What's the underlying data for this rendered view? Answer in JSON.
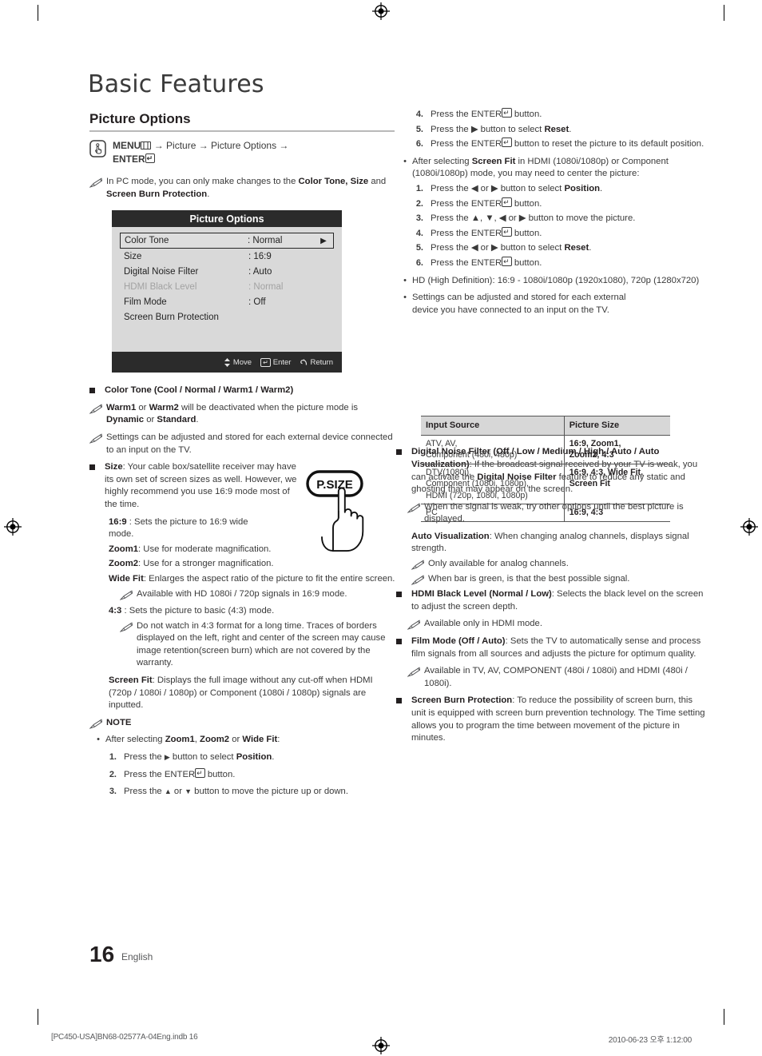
{
  "page": {
    "chapter_title": "Basic Features",
    "section_title": "Picture Options",
    "page_number": "16",
    "language": "English",
    "footer_file": "[PC450-USA]BN68-02577A-04Eng.indb   16",
    "footer_date": "2010-06-23   오후 1:12:00"
  },
  "menu_path": {
    "line1_a": "MENU",
    "line1_b": "→ Picture → Picture Options →",
    "line2": "ENTER"
  },
  "left": {
    "note_pc_mode_1": "In PC mode, you can only make changes to the ",
    "note_pc_mode_b1": "Color Tone, Size",
    "note_pc_mode_2": " and ",
    "note_pc_mode_b2": "Screen Burn Protection",
    "note_pc_mode_3": ".",
    "color_tone_heading": "Color Tone (Cool / Normal / Warm1 / Warm2)",
    "warm_note_b1": "Warm1",
    "warm_note_1": " or ",
    "warm_note_b2": "Warm2",
    "warm_note_2": " will be deactivated when the picture mode is ",
    "warm_note_b3": "Dynamic",
    "warm_note_3": " or ",
    "warm_note_b4": "Standard",
    "warm_note_4": ".",
    "settings_note": "Settings can be adjusted and stored for each external device connected to an input on the TV.",
    "size_label": "Size",
    "size_body": ": Your cable box/satellite receiver may have its own set of screen sizes as well. However, we highly recommend you use 16:9 mode most of the time.",
    "ratio_169_b": "16:9",
    "ratio_169_t": " : Sets the picture to 16:9 wide mode.",
    "zoom1_b": "Zoom1",
    "zoom1_t": ": Use for moderate magnification.",
    "zoom2_b": "Zoom2",
    "zoom2_t": ": Use for a stronger magnification.",
    "widefit_b": "Wide Fit",
    "widefit_t": ": Enlarges the aspect ratio of the picture to fit the entire screen.",
    "widefit_note": "Available with HD 1080i / 720p signals in 16:9 mode.",
    "ratio_43_b": "4:3",
    "ratio_43_t": " : Sets the picture to basic (4:3) mode.",
    "ratio_43_note": "Do not watch in 4:3 format for a long time. Traces of borders displayed on the left, right and center of the screen may cause image retention(screen burn) which are not covered by the warranty.",
    "screenfit_b": "Screen Fit",
    "screenfit_t": ": Displays the full image without any cut-off when HDMI (720p / 1080i / 1080p) or Component (1080i / 1080p) signals are inputted.",
    "note_heading": "NOTE",
    "note_bullet_1a": "After selecting ",
    "note_bullet_1b": "Zoom1",
    "note_bullet_1c": ", ",
    "note_bullet_1d": "Zoom2",
    "note_bullet_1e": " or ",
    "note_bullet_1f": "Wide Fit",
    "note_bullet_1g": ":",
    "steps": [
      {
        "n": "1.",
        "pre": "Press the ",
        "glyph": "▶",
        "mid": " button to select ",
        "bold": "Position",
        "post": "."
      },
      {
        "n": "2.",
        "pre": "Press the ENTER",
        "glyph": "",
        "mid": " button.",
        "bold": "",
        "post": ""
      },
      {
        "n": "3.",
        "pre": "Press the ",
        "glyph": "▲",
        "mid": " or ",
        "bold": "",
        "post": " button to move the picture up or down."
      }
    ]
  },
  "right": {
    "steps_a": [
      {
        "n": "4.",
        "text_pre": "Press the ENTER",
        "text_post": " button."
      },
      {
        "n": "5.",
        "text_pre": "Press the ▶ button to select ",
        "bold": "Reset",
        "text_post": "."
      },
      {
        "n": "6.",
        "text_pre": "Press the ENTER",
        "text_post": " button to reset the picture to its default position."
      }
    ],
    "bullet_screenfit_a": "After selecting ",
    "bullet_screenfit_b": "Screen Fit",
    "bullet_screenfit_c": " in HDMI (1080i/1080p) or Component (1080i/1080p) mode, you may need to center the picture:",
    "steps_b": [
      {
        "n": "1.",
        "text_pre": "Press the ◀ or ▶ button to select ",
        "bold": "Position",
        "text_post": "."
      },
      {
        "n": "2.",
        "text_pre": "Press the ENTER",
        "text_post": " button."
      },
      {
        "n": "3.",
        "text_pre": "Press the ▲, ▼, ◀ or ▶ button to move the picture.",
        "text_post": ""
      },
      {
        "n": "4.",
        "text_pre": "Press the ENTER",
        "text_post": " button."
      },
      {
        "n": "5.",
        "text_pre": "Press the ◀ or ▶ button to select ",
        "bold": "Reset",
        "text_post": "."
      },
      {
        "n": "6.",
        "text_pre": "Press the ENTER",
        "text_post": " button."
      }
    ],
    "bullet_hd": "HD (High Definition): 16:9 - 1080i/1080p (1920x1080), 720p (1280x720)",
    "bullet_settings": "Settings can be adjusted and stored for each external device you have connected to an input on the TV.",
    "dnf_b1": "Digital Noise Filter (Off / Low / Medium / High / Auto / Auto Visualization)",
    "dnf_t1": ": If the broadcast signal received by your TV is weak, you can activate the ",
    "dnf_b2": "Digital Noise Filter",
    "dnf_t2": " feature to reduce any static and ghosting that may appear on the screen.",
    "dnf_note": "When the signal is weak, try other options until the best picture is displayed.",
    "av_b": "Auto Visualization",
    "av_t": ": When changing analog channels, displays signal strength.",
    "av_note1": "Only available for analog channels.",
    "av_note2": "When bar is green, is that the best possible signal.",
    "hdmi_b": "HDMI Black Level (Normal / Low)",
    "hdmi_t": ": Selects the black level on the screen to adjust the screen depth.",
    "hdmi_note": "Available only in HDMI mode.",
    "film_b": "Film Mode (Off / Auto)",
    "film_t": ": Sets the TV to automatically sense and process film signals from all sources and adjusts the picture for optimum quality.",
    "film_note": "Available in TV, AV, COMPONENT (480i / 1080i) and HDMI (480i / 1080i).",
    "sbp_b": "Screen Burn Protection",
    "sbp_t": ": To reduce the possibility of screen burn, this unit is equipped with screen burn prevention technology. The Time setting allows you to program the time between movement of the picture in minutes."
  },
  "osd": {
    "title": "Picture Options",
    "rows": [
      {
        "label": "Color Tone",
        "value": ": Normal",
        "arrow": "▶",
        "state": "selected"
      },
      {
        "label": "Size",
        "value": ": 16:9",
        "arrow": "",
        "state": "normal"
      },
      {
        "label": "Digital Noise Filter",
        "value": ": Auto",
        "arrow": "",
        "state": "normal"
      },
      {
        "label": "HDMI Black Level",
        "value": ": Normal",
        "arrow": "",
        "state": "disabled"
      },
      {
        "label": "Film Mode",
        "value": ": Off",
        "arrow": "",
        "state": "normal"
      },
      {
        "label": "Screen Burn Protection",
        "value": "",
        "arrow": "",
        "state": "normal"
      }
    ],
    "footer": {
      "move": "Move",
      "enter": "Enter",
      "return": "Return"
    }
  },
  "remote_button": {
    "label": "P.SIZE"
  },
  "table": {
    "headers": [
      "Input Source",
      "Picture Size"
    ],
    "rows": [
      {
        "source": "ATV, AV,\nComponent (480i, 480p)",
        "size": "16:9, Zoom1,\nZoom2, 4:3"
      },
      {
        "source": "DTV(1080i),\nComponent (1080i, 1080p),\nHDMI (720p, 1080i, 1080p)",
        "size": "16:9, 4:3, Wide Fit,\nScreen Fit"
      },
      {
        "source": "PC",
        "size": "16:9, 4:3"
      }
    ]
  }
}
